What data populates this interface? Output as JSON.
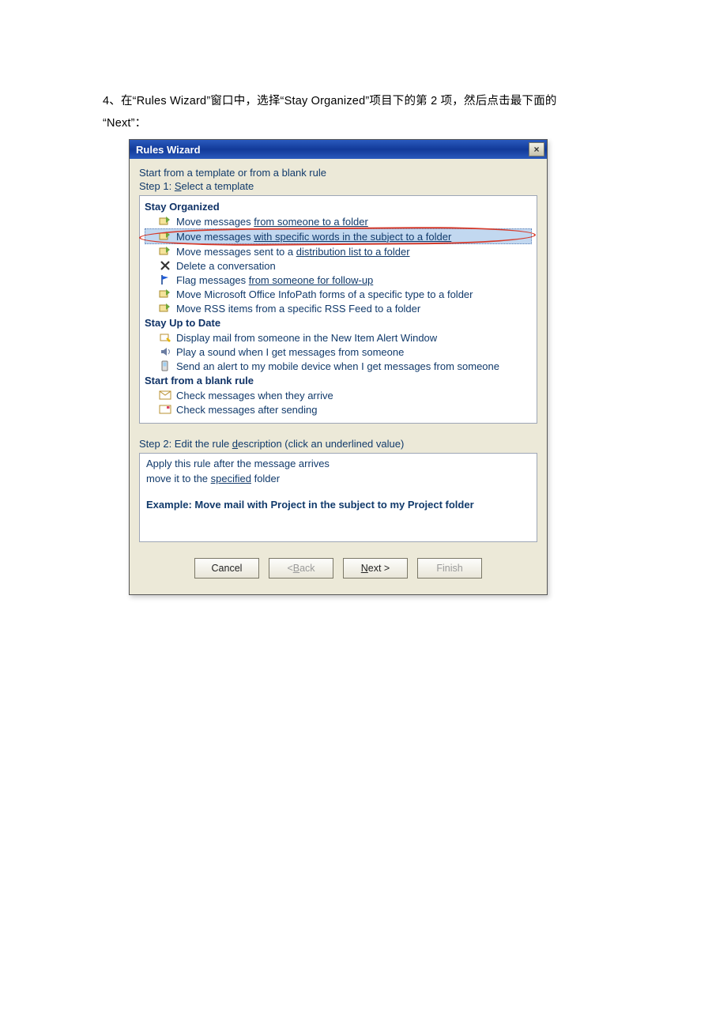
{
  "instruction": {
    "prefix": "4、在“",
    "app": "Rules Wizard",
    "mid1": "”窗口中，选择“",
    "cat": "Stay Organized",
    "mid2": "”项目下的第 2 项，然后点击最下面的",
    "line2prefix": "“",
    "next": "Next",
    "line2suffix": "”："
  },
  "dialog": {
    "title": "Rules Wizard",
    "close_label": "×",
    "start_from": "Start from a template or from a blank rule",
    "step1_label_pre": "Step 1: ",
    "step1_access": "S",
    "step1_label_post": "elect a template",
    "categories": {
      "stay_organized": "Stay Organized",
      "stay_uptodate": "Stay Up to Date",
      "blank": "Start from a blank rule"
    },
    "templates": {
      "so": [
        {
          "pre": "Move messages ",
          "u": "from someone to a folder",
          "selected": false
        },
        {
          "pre": "Move messages ",
          "u": "with specific words in the subject to a folder",
          "selected": true
        },
        {
          "pre": "Move messages sent to a ",
          "u": "distribution list to a folder",
          "selected": false
        },
        {
          "pre": "Delete a conversation",
          "u": "",
          "selected": false
        },
        {
          "pre": "Flag messages ",
          "u": "from someone for follow-up",
          "selected": false
        },
        {
          "pre": "Move Microsoft Office InfoPath forms of a specific type to a folder",
          "u": "",
          "selected": false
        },
        {
          "pre": "Move RSS items from a specific RSS Feed to a folder",
          "u": "",
          "selected": false
        }
      ],
      "su": [
        {
          "pre": "Display mail from someone in the New Item Alert Window",
          "u": ""
        },
        {
          "pre": "Play a sound when I get messages from someone",
          "u": ""
        },
        {
          "pre": "Send an alert to my mobile device when I get messages from someone",
          "u": ""
        }
      ],
      "bl": [
        {
          "pre": "Check messages when they arrive",
          "u": ""
        },
        {
          "pre": "Check messages after sending",
          "u": ""
        }
      ]
    },
    "step2_label_pre": "Step 2: Edit the rule ",
    "step2_access": "d",
    "step2_label_post": "escription (click an underlined value)",
    "desc": {
      "line1": "Apply this rule after the message arrives",
      "line2_pre": "move it to the ",
      "line2_link": "specified",
      "line2_post": " folder",
      "example": "Example: Move mail with Project in the subject to my Project folder"
    },
    "buttons": {
      "cancel": "Cancel",
      "back_pre": "< ",
      "back_u": "B",
      "back_post": "ack",
      "next_u": "N",
      "next_post": "ext >",
      "finish": "Finish"
    }
  },
  "icons": {
    "move": "move-to-folder",
    "delete": "delete-x",
    "flag": "flag",
    "alert": "alert",
    "sound": "sound",
    "mobile": "mobile",
    "envelope": "envelope",
    "envelope2": "envelope-stamp"
  }
}
